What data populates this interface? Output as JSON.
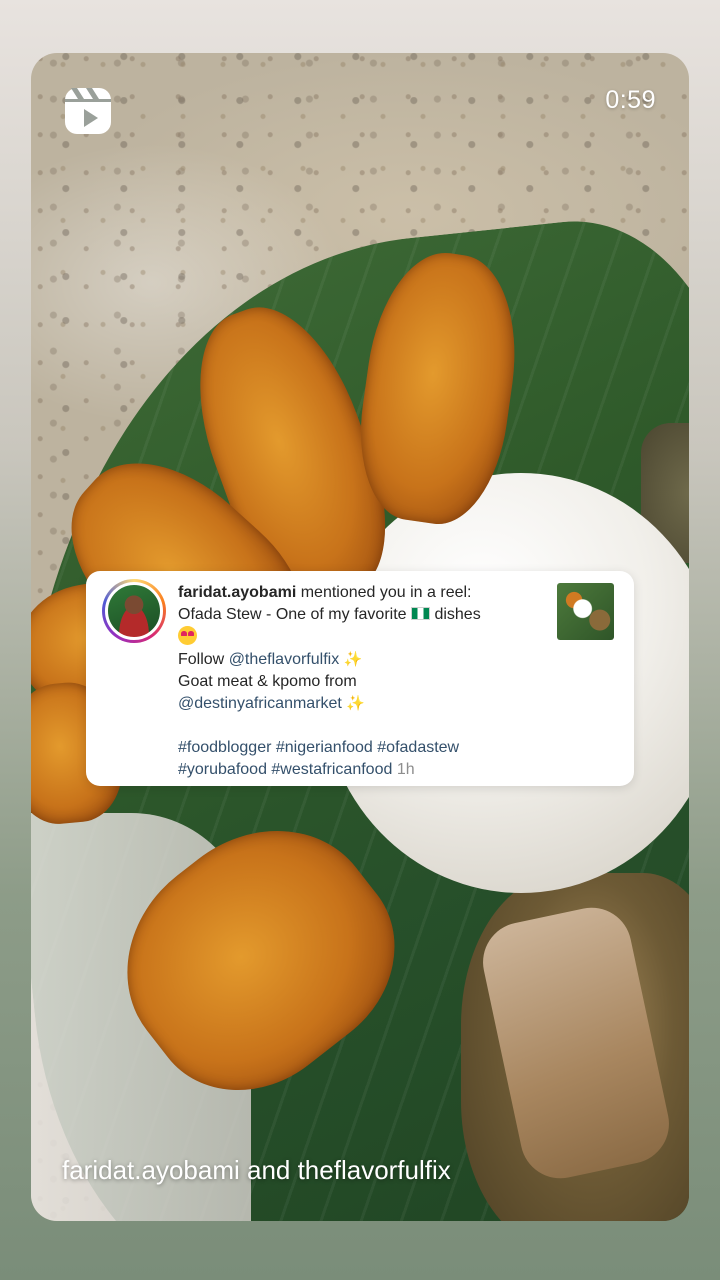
{
  "reel": {
    "duration": "0:59",
    "attribution": "faridat.ayobami and theflavorfulfix",
    "icon": "reel-icon"
  },
  "mention": {
    "username": "faridat.ayobami",
    "action": " mentioned you in a reel:",
    "line1": "Ofada Stew - One of my favorite",
    "line1_end": " dishes",
    "follow_prefix": "Follow ",
    "follow_handle": "@theflavorfulfix",
    "line3": "Goat meat & kpomo from",
    "market_handle": "@destinyafricanmarket",
    "hashtags_line1": "#foodblogger #nigerianfood #ofadastew",
    "hashtags_line2": "#yorubafood #westafricanfood",
    "time_ago": " 1h",
    "flag": "nigeria-flag",
    "emoji": "heart-eyes-emoji",
    "sparkle": "✨"
  }
}
